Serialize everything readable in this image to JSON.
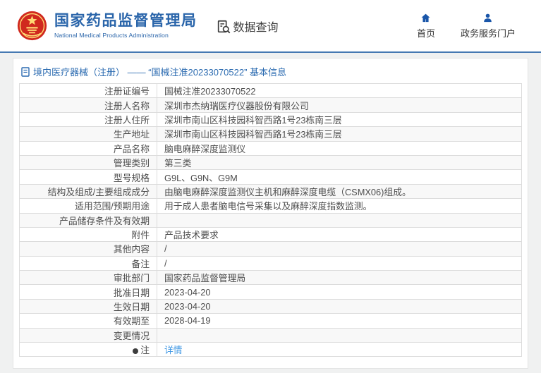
{
  "header": {
    "org_name_cn": "国家药品监督管理局",
    "org_name_en": "National Medical Products Administration",
    "section_label": "数据查询",
    "nav": [
      {
        "label": "首页",
        "icon": "home-icon"
      },
      {
        "label": "政务服务门户",
        "icon": "user-icon"
      }
    ],
    "logo_icon": "national-emblem-icon"
  },
  "breadcrumb": {
    "icon": "document-icon",
    "text": "境内医疗器械（注册） —— “国械注准20233070522” 基本信息"
  },
  "table": {
    "rows": [
      {
        "label": "注册证编号",
        "value": "国械注准20233070522"
      },
      {
        "label": "注册人名称",
        "value": "深圳市杰纳瑞医疗仪器股份有限公司"
      },
      {
        "label": "注册人住所",
        "value": "深圳市南山区科技园科智西路1号23栋南三层"
      },
      {
        "label": "生产地址",
        "value": "深圳市南山区科技园科智西路1号23栋南三层"
      },
      {
        "label": "产品名称",
        "value": "脑电麻醉深度监测仪"
      },
      {
        "label": "管理类别",
        "value": "第三类"
      },
      {
        "label": "型号规格",
        "value": "G9L、G9N、G9M"
      },
      {
        "label": "结构及组成/主要组成成分",
        "value": "由脑电麻醉深度监测仪主机和麻醉深度电缆（CSMX06)组成。"
      },
      {
        "label": "适用范围/预期用途",
        "value": "用于成人患者脑电信号采集以及麻醉深度指数监测。"
      },
      {
        "label": "产品储存条件及有效期",
        "value": ""
      },
      {
        "label": "附件",
        "value": "产品技术要求"
      },
      {
        "label": "其他内容",
        "value": "/"
      },
      {
        "label": "备注",
        "value": "/"
      },
      {
        "label": "审批部门",
        "value": "国家药品监督管理局"
      },
      {
        "label": "批准日期",
        "value": "2023-04-20"
      },
      {
        "label": "生效日期",
        "value": "2023-04-20"
      },
      {
        "label": "有效期至",
        "value": "2028-04-19"
      },
      {
        "label": "变更情况",
        "value": ""
      },
      {
        "label": "注",
        "value": "详情",
        "is_link": true,
        "label_icon": "balloon-icon"
      }
    ]
  },
  "colors": {
    "brand_blue": "#2a65aa",
    "icon_blue": "#1a56a9",
    "link_blue": "#3f97e4",
    "header_divider": "#4679b2",
    "emblem_red": "#d0281e",
    "emblem_gold": "#ffd873",
    "row_alt_bg": "#f8f8f8",
    "table_border": "#dcdcdc",
    "body_text": "#4d4d4d",
    "page_bg": "#f0f1f1"
  }
}
